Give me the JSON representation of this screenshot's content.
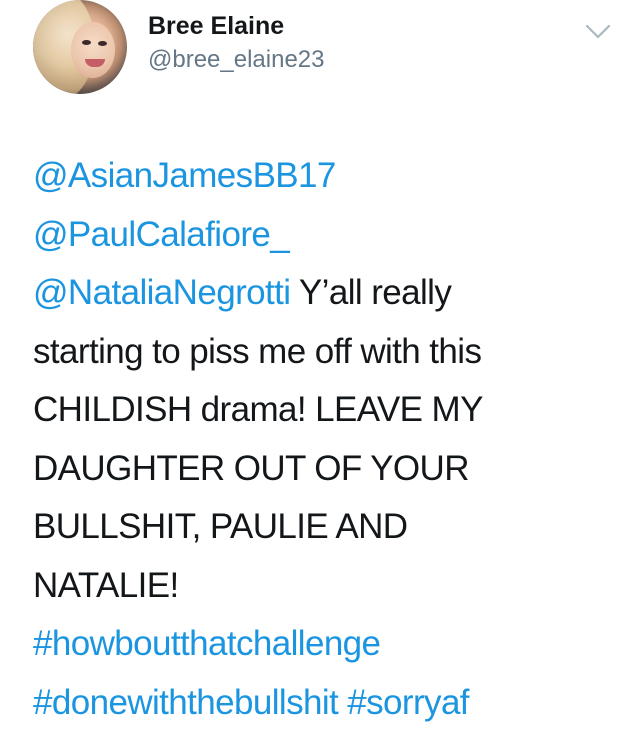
{
  "tweet": {
    "display_name": "Bree Elaine",
    "handle": "@bree_elaine23",
    "avatar_alt": "avatar",
    "menu_icon": "chevron-down-icon",
    "text": {
      "mention_1": "@AsianJamesBB17",
      "mention_2": "@PaulCalafiore_",
      "mention_3": "@NataliaNegrotti",
      "line_3_rest": " Y’all really",
      "line_4": "starting to piss me off with this",
      "line_5": "CHILDISH drama! LEAVE MY",
      "line_6": "DAUGHTER OUT OF YOUR",
      "line_7": "BULLSHIT, PAULIE AND",
      "line_8": "NATALIE!",
      "hashtag_1": "#howboutthatchallenge",
      "hashtag_2": "#donewiththebullshit",
      "hashtag_3": "#sorryaf"
    },
    "colors": {
      "link": "#1b95e0",
      "text": "#14171a",
      "secondary": "#657786",
      "chevron": "#aab8c2"
    }
  }
}
